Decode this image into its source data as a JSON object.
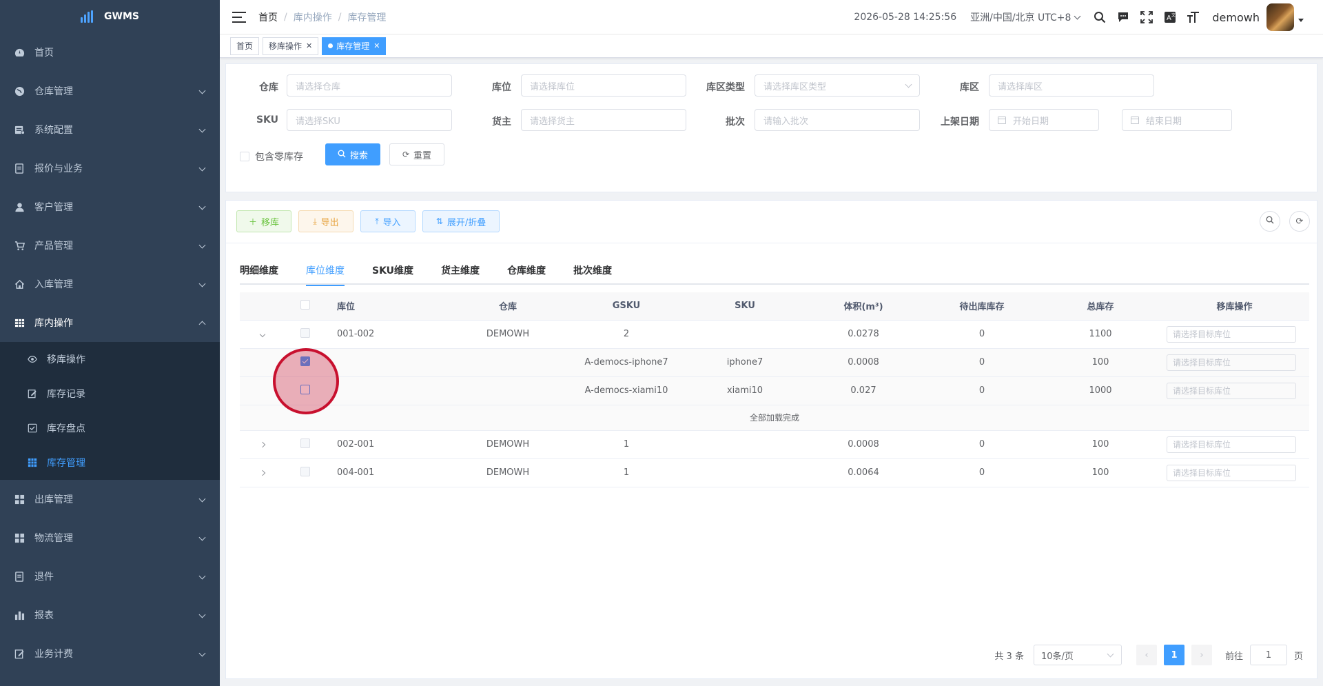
{
  "app": {
    "name": "GWMS"
  },
  "sidebar": {
    "items": [
      {
        "label": "首页",
        "icon": "dashboard-icon"
      },
      {
        "label": "仓库管理",
        "icon": "globe-icon"
      },
      {
        "label": "系统配置",
        "icon": "config-icon"
      },
      {
        "label": "报价与业务",
        "icon": "document-icon"
      },
      {
        "label": "客户管理",
        "icon": "user-icon"
      },
      {
        "label": "产品管理",
        "icon": "cart-icon"
      },
      {
        "label": "入库管理",
        "icon": "home-icon"
      },
      {
        "label": "库内操作",
        "icon": "table-icon"
      }
    ],
    "sub_items": [
      {
        "label": "移库操作",
        "icon": "eye-icon"
      },
      {
        "label": "库存记录",
        "icon": "edit-icon"
      },
      {
        "label": "库存盘点",
        "icon": "checkbox-icon"
      },
      {
        "label": "库存管理",
        "icon": "grid-icon"
      }
    ],
    "items_after": [
      {
        "label": "出库管理",
        "icon": "apps-icon"
      },
      {
        "label": "物流管理",
        "icon": "apps-icon"
      },
      {
        "label": "退件",
        "icon": "document-icon"
      },
      {
        "label": "报表",
        "icon": "chart-icon"
      },
      {
        "label": "业务计费",
        "icon": "edit-icon"
      }
    ]
  },
  "navbar": {
    "breadcrumb": [
      "首页",
      "库内操作",
      "库存管理"
    ],
    "datetime": "2026-05-28 14:25:56",
    "timezone": "亚洲/中国/北京 UTC+8",
    "username": "demowh"
  },
  "tags": [
    {
      "label": "首页"
    },
    {
      "label": "移库操作"
    },
    {
      "label": "库存管理"
    }
  ],
  "filters": {
    "warehouse": {
      "label": "仓库",
      "placeholder": "请选择仓库"
    },
    "location": {
      "label": "库位",
      "placeholder": "请选择库位"
    },
    "zone_type": {
      "label": "库区类型",
      "placeholder": "请选择库区类型"
    },
    "zone": {
      "label": "库区",
      "placeholder": "请选择库区"
    },
    "sku": {
      "label": "SKU",
      "placeholder": "请选择SKU"
    },
    "owner": {
      "label": "货主",
      "placeholder": "请选择货主"
    },
    "batch": {
      "label": "批次",
      "placeholder": "请输入批次"
    },
    "shelf_date": {
      "label": "上架日期",
      "start_placeholder": "开始日期",
      "end_placeholder": "结束日期"
    },
    "include_zero": "包含零库存",
    "search_label": "搜索",
    "reset_label": "重置"
  },
  "toolbar": {
    "move": "移库",
    "export": "导出",
    "import": "导入",
    "expand": "展开/折叠"
  },
  "tabs": [
    "明细维度",
    "库位维度",
    "SKU维度",
    "货主维度",
    "仓库维度",
    "批次维度"
  ],
  "table": {
    "headers": [
      "库位",
      "仓库",
      "GSKU",
      "SKU",
      "体积(m³)",
      "待出库库存",
      "总库存",
      "移库操作"
    ],
    "target_placeholder": "请选择目标库位",
    "loaded_text": "全部加载完成",
    "groups": [
      {
        "location": "001-002",
        "warehouse": "DEMOWH",
        "gsku": "2",
        "sku": "",
        "volume": "0.0278",
        "pending": "0",
        "total": "1100",
        "expanded": true,
        "children": [
          {
            "gsku": "A-democs-iphone7",
            "sku": "iphone7",
            "volume": "0.0008",
            "pending": "0",
            "total": "100",
            "checked": true
          },
          {
            "gsku": "A-democs-xiami10",
            "sku": "xiami10",
            "volume": "0.027",
            "pending": "0",
            "total": "1000",
            "checked": false
          }
        ]
      },
      {
        "location": "002-001",
        "warehouse": "DEMOWH",
        "gsku": "1",
        "sku": "",
        "volume": "0.0008",
        "pending": "0",
        "total": "100",
        "expanded": false
      },
      {
        "location": "004-001",
        "warehouse": "DEMOWH",
        "gsku": "1",
        "sku": "",
        "volume": "0.0064",
        "pending": "0",
        "total": "100",
        "expanded": false
      }
    ]
  },
  "pagination": {
    "total_text": "共 3 条",
    "page_size": "10条/页",
    "current": "1",
    "goto_prefix": "前往",
    "goto_value": "1",
    "goto_suffix": "页"
  },
  "colors": {
    "sidebar_bg": "#304156",
    "primary": "#409eff",
    "highlight": "#c8102e"
  }
}
